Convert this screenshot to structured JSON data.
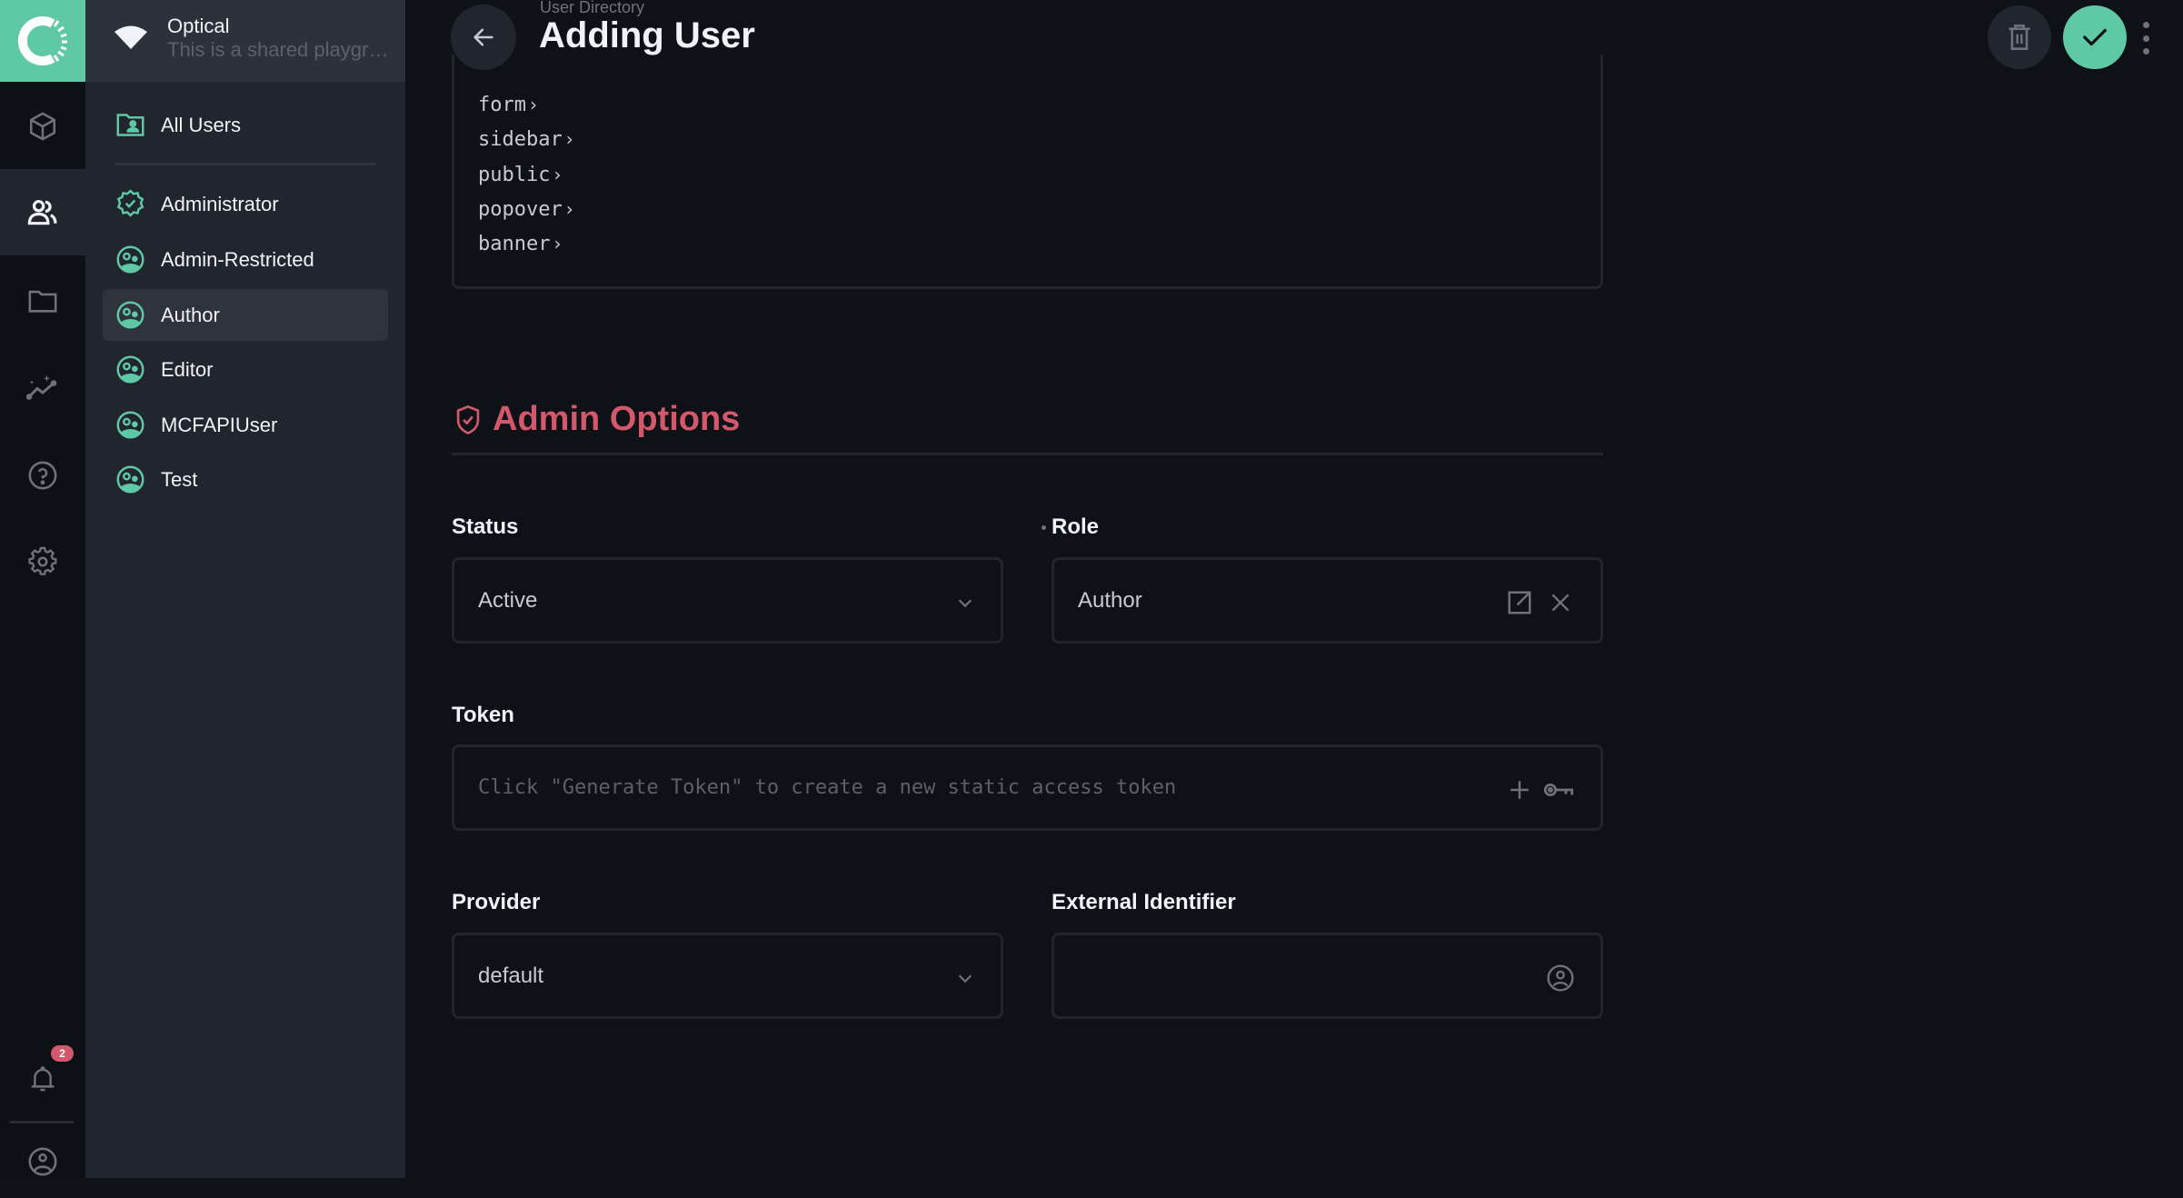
{
  "project": {
    "name": "Optical",
    "description": "This is a shared playground"
  },
  "rail": {
    "items": [
      {
        "name": "content",
        "icon": "cube-icon"
      },
      {
        "name": "user-directory",
        "icon": "users-icon",
        "active": true
      },
      {
        "name": "files",
        "icon": "folder-icon"
      },
      {
        "name": "insights",
        "icon": "chart-sparkle-icon"
      },
      {
        "name": "help",
        "icon": "help-circle-icon"
      },
      {
        "name": "settings",
        "icon": "gear-icon"
      }
    ],
    "notifications_count": "2"
  },
  "nav": {
    "all_users": "All Users",
    "roles": [
      {
        "label": "Administrator",
        "icon": "badge-check-icon"
      },
      {
        "label": "Admin-Restricted",
        "icon": "users-circle-icon"
      },
      {
        "label": "Author",
        "icon": "users-circle-icon",
        "active": true
      },
      {
        "label": "Editor",
        "icon": "users-circle-icon"
      },
      {
        "label": "MCFAPIUser",
        "icon": "users-circle-icon"
      },
      {
        "label": "Test",
        "icon": "users-circle-icon"
      }
    ]
  },
  "header": {
    "breadcrumb": "User Directory",
    "title": "Adding User"
  },
  "code_tree": [
    "form",
    "sidebar",
    "public",
    "popover",
    "banner"
  ],
  "admin": {
    "section_title": "Admin Options",
    "status": {
      "label": "Status",
      "value": "Active"
    },
    "role": {
      "label": "Role",
      "value": "Author"
    },
    "token": {
      "label": "Token",
      "placeholder": "Click \"Generate Token\" to create a new static access token"
    },
    "provider": {
      "label": "Provider",
      "value": "default"
    },
    "external_identifier": {
      "label": "External Identifier",
      "value": ""
    }
  },
  "colors": {
    "accent": "#5fc9a6",
    "danger": "#d4586b",
    "background": "#0e1116",
    "panel": "#21252d"
  }
}
